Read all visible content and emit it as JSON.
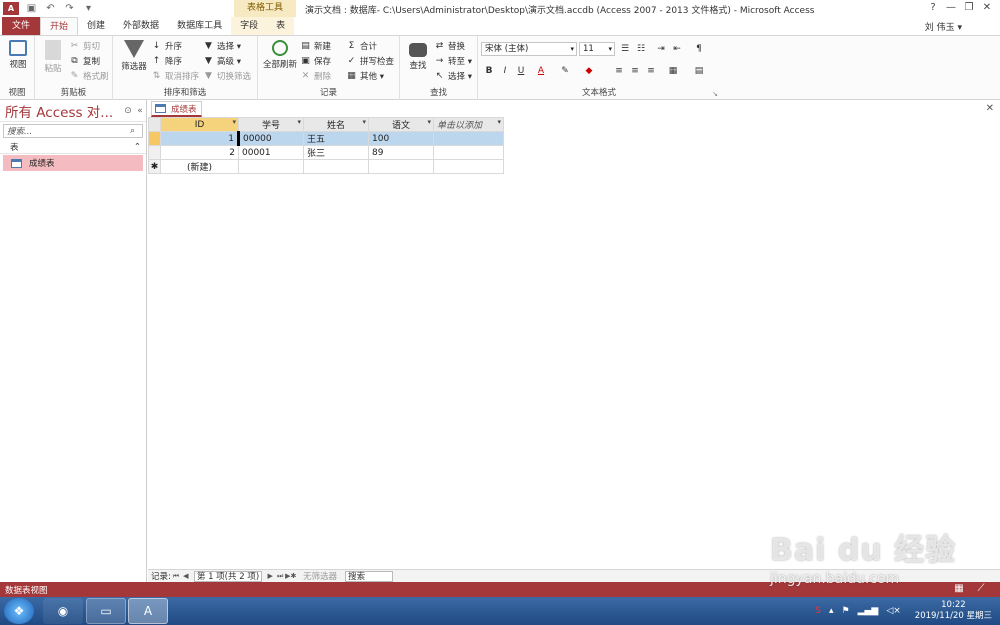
{
  "titlebar": {
    "logo": "A",
    "context_tools": "表格工具",
    "title": "演示文档 : 数据库- C:\\Users\\Administrator\\Desktop\\演示文档.accdb (Access 2007 - 2013 文件格式) - Microsoft Access",
    "help": "?",
    "min": "—",
    "restore": "❐",
    "close": "✕"
  },
  "tabs": [
    "文件",
    "开始",
    "创建",
    "外部数据",
    "数据库工具",
    "字段",
    "表"
  ],
  "user": "刘 伟玉 ▾",
  "ribbon": {
    "view": {
      "label": "视图",
      "group": "视图"
    },
    "clipboard": {
      "paste": "粘贴",
      "cut": "剪切",
      "copy": "复制",
      "painter": "格式刷",
      "group": "剪贴板"
    },
    "sort": {
      "filter": "筛选器",
      "asc": "升序",
      "desc": "降序",
      "clear": "取消排序",
      "select": "选择 ▾",
      "advanced": "高级 ▾",
      "toggle": "切换筛选",
      "group": "排序和筛选"
    },
    "records": {
      "refresh": "全部刷新",
      "new": "新建",
      "save": "保存",
      "delete": "删除",
      "totals": "合计",
      "spell": "拼写检查",
      "more": "其他 ▾",
      "group": "记录"
    },
    "find": {
      "find": "查找",
      "replace": "替换",
      "goto": "转至 ▾",
      "select": "选择 ▾",
      "group": "查找"
    },
    "text": {
      "font": "宋体 (主体)",
      "size": "11",
      "group": "文本格式"
    }
  },
  "nav": {
    "title": "所有 Access 对...",
    "search_placeholder": "搜索...",
    "category": "表",
    "item": "成绩表"
  },
  "doc": {
    "tab": "成绩表",
    "columns": [
      "ID",
      "学号",
      "姓名",
      "语文",
      "单击以添加"
    ],
    "rows": [
      {
        "id": "1",
        "xh": "00000",
        "name": "王五",
        "yw": "100"
      },
      {
        "id": "2",
        "xh": "00001",
        "name": "张三",
        "yw": "89"
      }
    ],
    "new_row": "(新建)"
  },
  "recnav": {
    "label": "记录:",
    "pos": "第 1 项(共 2 项)",
    "nofilter": "无筛选器",
    "search": "搜索"
  },
  "status": {
    "text": "数据表视图"
  },
  "taskbar": {
    "time": "10:22",
    "date": "2019/11/20 星期三",
    "lang": "S"
  },
  "watermark": {
    "brand": "Bai du 经验",
    "url": "jingyan.baidu.com"
  },
  "colors": {
    "accent": "#a4373a",
    "selection": "#bcd6ee",
    "context": "#f7e9c1"
  }
}
